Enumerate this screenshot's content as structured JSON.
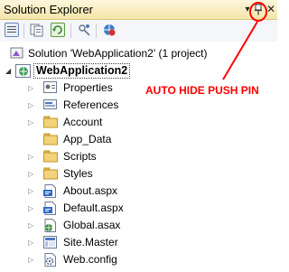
{
  "window": {
    "title": "Solution Explorer",
    "dropdown_icon": "dropdown-arrow-icon",
    "pin_icon": "push-pin-icon",
    "close_icon": "close-icon"
  },
  "toolbar": {
    "buttons": [
      {
        "name": "properties-icon"
      },
      {
        "name": "show-all-files-icon"
      },
      {
        "name": "refresh-icon"
      },
      {
        "name": "view-class-diagram-icon"
      },
      {
        "name": "asp-net-configuration-icon"
      }
    ]
  },
  "tree": {
    "solution": "Solution 'WebApplication2' (1 project)",
    "project": "WebApplication2",
    "items": [
      {
        "label": "Properties",
        "icon": "properties-icon",
        "expandable": true
      },
      {
        "label": "References",
        "icon": "references-icon",
        "expandable": true
      },
      {
        "label": "Account",
        "icon": "folder-icon",
        "expandable": true
      },
      {
        "label": "App_Data",
        "icon": "folder-icon",
        "expandable": false
      },
      {
        "label": "Scripts",
        "icon": "folder-icon",
        "expandable": true
      },
      {
        "label": "Styles",
        "icon": "folder-icon",
        "expandable": true
      },
      {
        "label": "About.aspx",
        "icon": "aspx-file-icon",
        "expandable": true
      },
      {
        "label": "Default.aspx",
        "icon": "aspx-file-icon",
        "expandable": true
      },
      {
        "label": "Global.asax",
        "icon": "asax-file-icon",
        "expandable": true
      },
      {
        "label": "Site.Master",
        "icon": "master-file-icon",
        "expandable": true
      },
      {
        "label": "Web.config",
        "icon": "config-file-icon",
        "expandable": true
      }
    ]
  },
  "annotation": {
    "text": "AUTO HIDE PUSH PIN",
    "color": "#ff0000"
  }
}
